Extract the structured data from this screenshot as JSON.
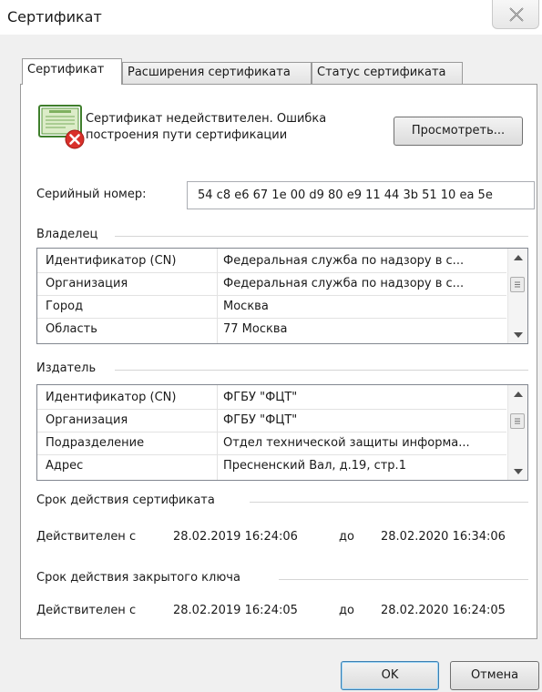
{
  "window": {
    "title": "Сертификат"
  },
  "tabs": [
    {
      "label": "Сертификат"
    },
    {
      "label": "Расширения сертификата"
    },
    {
      "label": "Статус сертификата"
    }
  ],
  "status": {
    "line1": "Сертификат недействителен. Ошибка",
    "line2": "построения пути сертификации",
    "view_button": "Просмотреть..."
  },
  "serial": {
    "label": "Серийный номер:",
    "value": "54 c8 e6 67 1e 00 d9 80 e9 11 44 3b 51 10 ea 5e"
  },
  "owner": {
    "title": "Владелец",
    "rows": [
      {
        "name": "Идентификатор (CN)",
        "value": "Федеральная служба по надзору в с..."
      },
      {
        "name": "Организация",
        "value": "Федеральная служба по надзору в с..."
      },
      {
        "name": "Город",
        "value": "Москва"
      },
      {
        "name": "Область",
        "value": "77 Москва"
      }
    ]
  },
  "issuer": {
    "title": "Издатель",
    "rows": [
      {
        "name": "Идентификатор (CN)",
        "value": "ФГБУ \"ФЦТ\""
      },
      {
        "name": "Организация",
        "value": "ФГБУ \"ФЦТ\""
      },
      {
        "name": "Подразделение",
        "value": "Отдел технической защиты информа..."
      },
      {
        "name": "Адрес",
        "value": "Пресненский Вал, д.19, стр.1"
      }
    ]
  },
  "validity": {
    "title": "Срок действия сертификата",
    "from_label": "Действителен с",
    "from": "28.02.2019 16:24:06",
    "to_label": "до",
    "to": "28.02.2020 16:34:06"
  },
  "key_validity": {
    "title": "Срок действия закрытого ключа",
    "from_label": "Действителен с",
    "from": "28.02.2019 16:24:05",
    "to_label": "до",
    "to": "28.02.2020 16:24:05"
  },
  "buttons": {
    "ok": "OK",
    "cancel": "Отмена"
  },
  "icons": {
    "certificate": "certificate-error-icon",
    "close": "close-icon",
    "scroll_up": "scroll-up-arrow-icon",
    "scroll_down": "scroll-down-arrow-icon"
  }
}
